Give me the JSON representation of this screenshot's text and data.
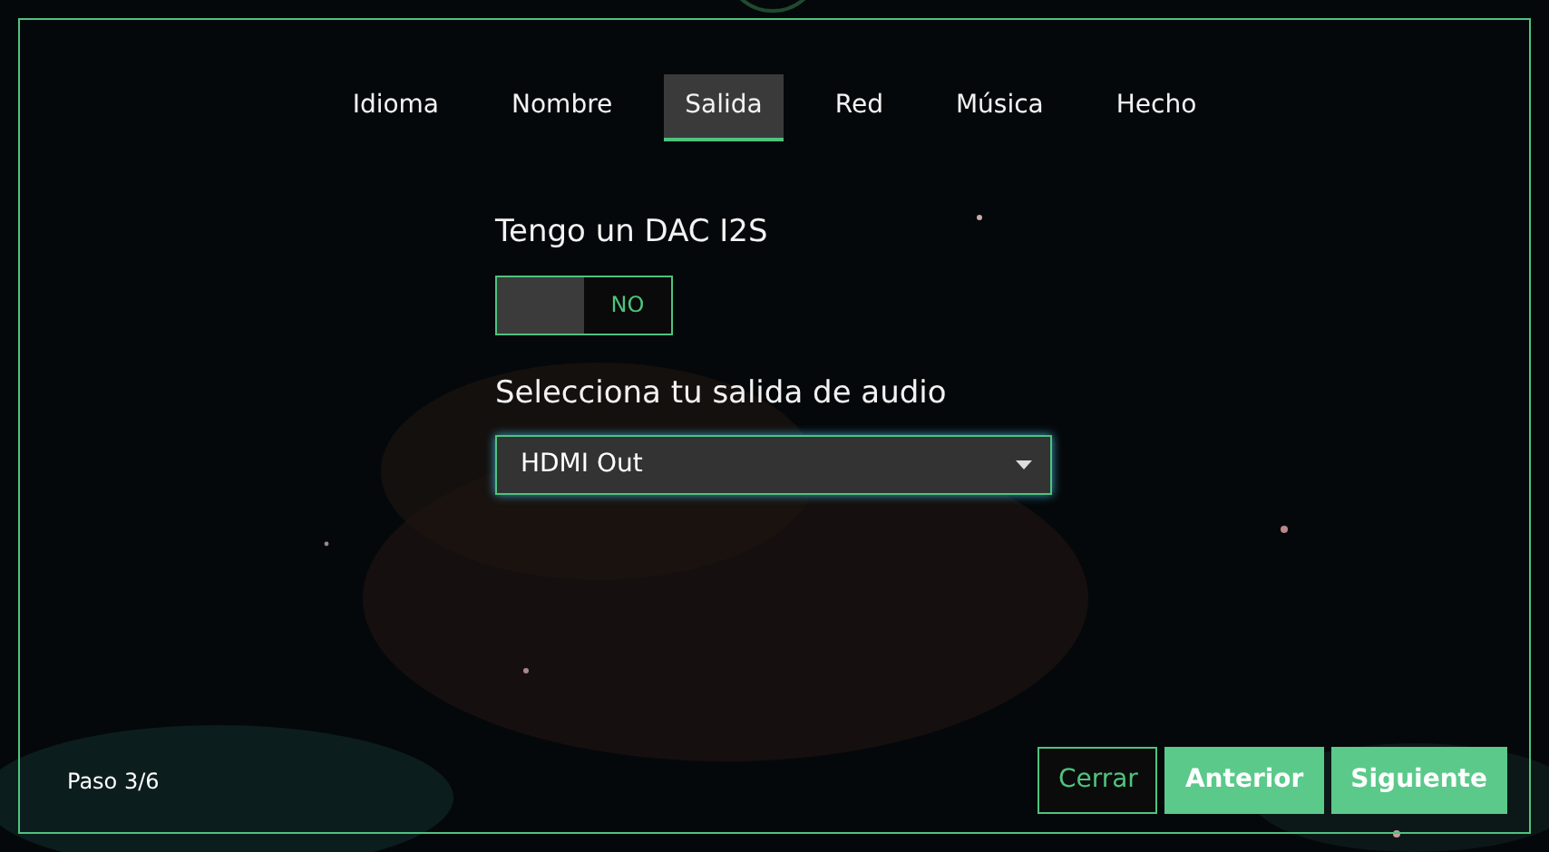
{
  "tabs": [
    {
      "label": "Idioma",
      "selected": false
    },
    {
      "label": "Nombre",
      "selected": false
    },
    {
      "label": "Salida",
      "selected": true
    },
    {
      "label": "Red",
      "selected": false
    },
    {
      "label": "Música",
      "selected": false
    },
    {
      "label": "Hecho",
      "selected": false
    }
  ],
  "dac": {
    "label": "Tengo un DAC I2S",
    "on": false,
    "state_text": "NO"
  },
  "output": {
    "label": "Selecciona tu salida de audio",
    "value": "HDMI Out"
  },
  "step": "Paso 3/6",
  "buttons": [
    {
      "label": "Cerrar",
      "kind": "outline"
    },
    {
      "label": "Anterior",
      "kind": "filled"
    },
    {
      "label": "Siguiente",
      "kind": "filled"
    }
  ]
}
